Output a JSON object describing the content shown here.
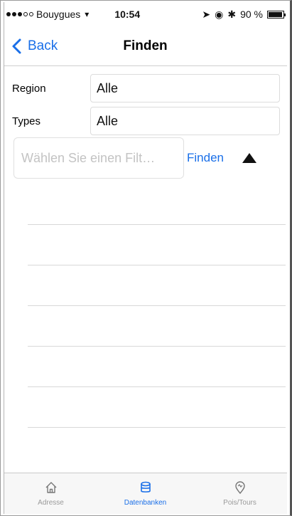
{
  "status_bar": {
    "carrier": "Bouygues",
    "time": "10:54",
    "battery": "90 %"
  },
  "nav": {
    "back_label": "Back",
    "title": "Finden"
  },
  "filters": {
    "region_label": "Region",
    "region_value": "Alle",
    "types_label": "Types",
    "types_value": "Alle"
  },
  "search": {
    "placeholder": "Wählen Sie einen Filt…",
    "value": "",
    "find_label": "Finden"
  },
  "results": {
    "rows": [
      "",
      "",
      "",
      "",
      "",
      ""
    ]
  },
  "tab_bar": {
    "tabs": [
      {
        "label": "Adresse",
        "icon": "home-icon",
        "active": false
      },
      {
        "label": "Datenbanken",
        "icon": "database-icon",
        "active": true
      },
      {
        "label": "Pois/Tours",
        "icon": "poi-icon",
        "active": false
      }
    ]
  },
  "colors": {
    "accent": "#1a6fe8",
    "inactive_tab": "#9a9a9a"
  }
}
